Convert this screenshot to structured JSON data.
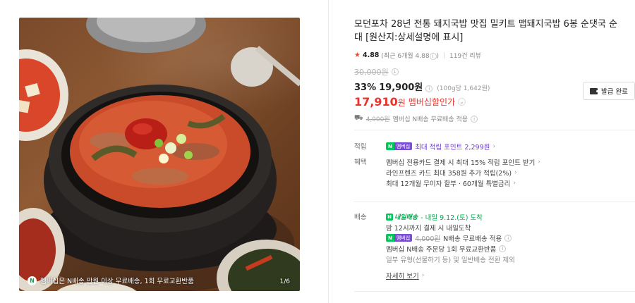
{
  "colors": {
    "accent_red": "#e8342d",
    "naver_green": "#03c75a",
    "membership_purple": "#7b4dd6",
    "star": "#f0472c"
  },
  "photo": {
    "caption": "멤버십은 N배송 만원 이상 무료배송, 1회 무료교환반품",
    "counter": "1/6"
  },
  "product": {
    "title": "모던포차 28년 전통 돼지국밥 맛집 밀키트 맵돼지국밥 6봉 순댓국 순대 [원산지:상세설명에 표시]",
    "rating": {
      "score": "4.88",
      "recent": "(최근 6개월 4.88",
      "recent_close": ")",
      "reviews": "119건 리뷰"
    },
    "price": {
      "original": "30,000원",
      "discount_pct": "33%",
      "sale": "19,900원",
      "unit_price": "(100g당 1,642원)",
      "member_price": "17,910",
      "member_unit": "원",
      "member_label": "멤버십할인가"
    },
    "coupon_button": "발급 완료",
    "shipping_summary": {
      "strike": "4,000원",
      "text": "멤버십 N배송 무료배송 적용"
    }
  },
  "points": {
    "key": "적립",
    "badge_n": "N",
    "badge_m": "멤버십",
    "text": "최대 적립 포인트 2,299원"
  },
  "benefits": {
    "key": "혜택",
    "items": [
      "멤버십 전용카드 결제 시 최대 15% 적립 포인트 받기",
      "라인프렌즈 카드 최대 358원 추가 적립(2%)",
      "최대 12개월 무이자 할부 · 60개월 특별금리"
    ]
  },
  "delivery": {
    "key": "배송",
    "arrival_badge": "내일배송",
    "arrival_text": "- 내일 9.12.(토) 도착",
    "cutoff": "밤 12시까지 결제 시 내일도착",
    "badge_n": "N",
    "badge_m": "멤버십",
    "fee_strike": "4,000원",
    "fee_text": "N배송 무료배송 적용",
    "return_text": "멤버십 N배송 주문당 1회 무료교환반품",
    "exclude_text": "일부 유형(선물하기 등) 및 일반배송 전환 제외",
    "details_link": "자세히 보기"
  }
}
